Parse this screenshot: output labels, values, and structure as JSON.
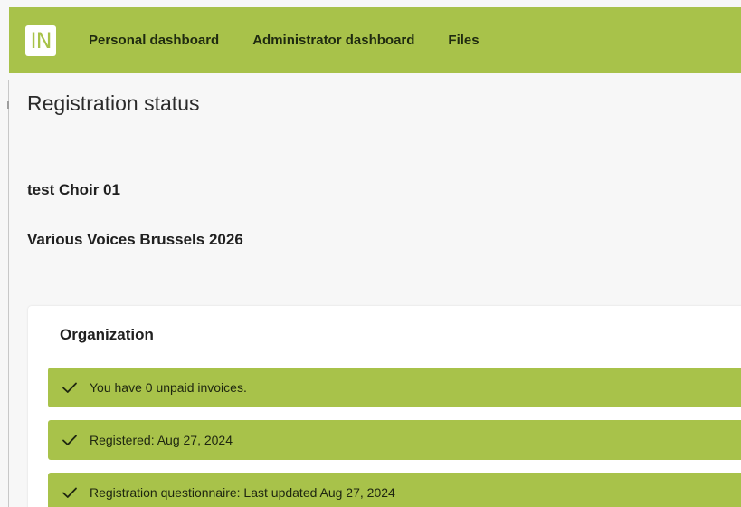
{
  "header": {
    "logo_text": "IN",
    "nav": [
      {
        "label": "Personal dashboard"
      },
      {
        "label": "Administrator dashboard"
      },
      {
        "label": "Files"
      }
    ]
  },
  "page": {
    "title": "Registration status",
    "choir": "test Choir 01",
    "event": "Various Voices Brussels 2026"
  },
  "organization": {
    "title": "Organization",
    "items": [
      {
        "icon": "check-icon",
        "text": "You have 0 unpaid invoices."
      },
      {
        "icon": "check-icon",
        "text": "Registered: Aug 27, 2024"
      },
      {
        "icon": "check-icon",
        "text": "Registration questionnaire: Last updated Aug 27, 2024"
      }
    ]
  },
  "colors": {
    "brand": "#a8c24a",
    "background": "#f7f7f7",
    "card": "#ffffff"
  }
}
